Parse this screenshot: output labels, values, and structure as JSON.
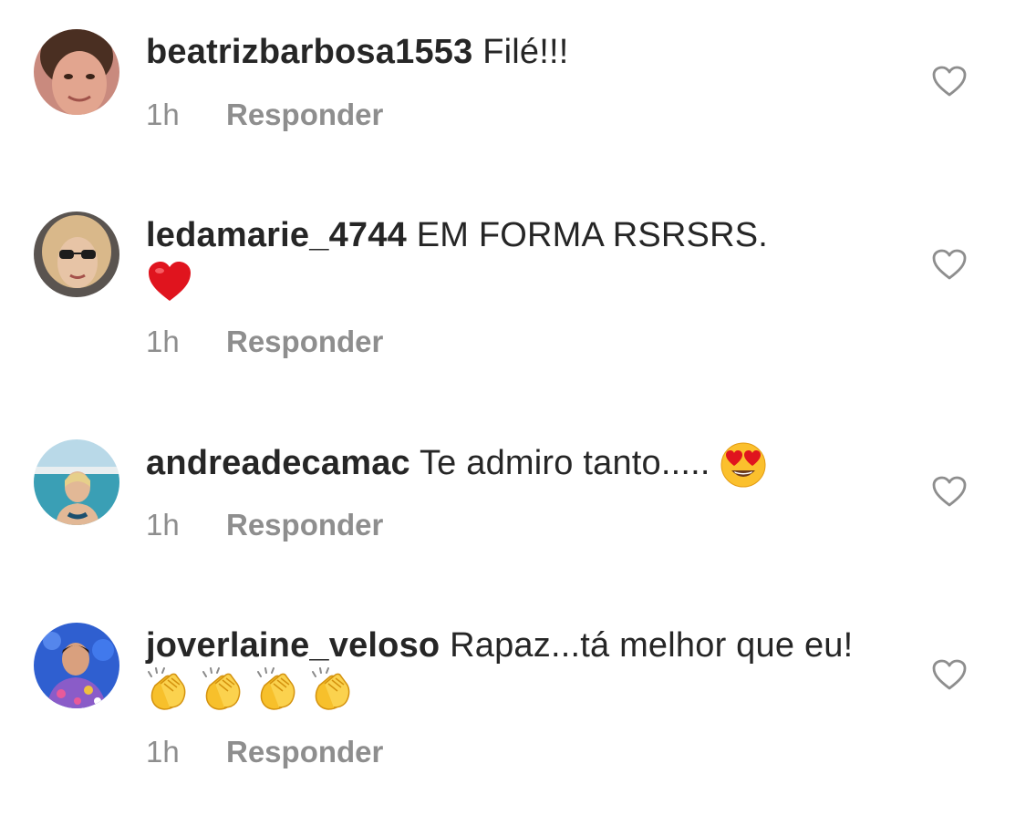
{
  "comments": [
    {
      "username": "beatrizbarbosa1553",
      "text": "Filé!!!",
      "time": "1h",
      "reply_label": "Responder"
    },
    {
      "username": "ledamarie_4744",
      "text": "EM FORMA RSRSRS.",
      "emoji": "red-heart",
      "time": "1h",
      "reply_label": "Responder"
    },
    {
      "username": "andreadecamac",
      "text": "Te admiro tanto.....",
      "emoji": "heart-eyes-face",
      "time": "1h",
      "reply_label": "Responder"
    },
    {
      "username": "joverlaine_veloso",
      "text": "Rapaz...tá  melhor que eu!",
      "emoji": "clapping-hands x4",
      "time": "1h",
      "reply_label": "Responder"
    }
  ],
  "colors": {
    "text": "#262626",
    "secondary": "#8e8e8e",
    "background": "#ffffff"
  },
  "icons": {
    "like": "heart-outline-icon",
    "avatar": "user-avatar"
  }
}
